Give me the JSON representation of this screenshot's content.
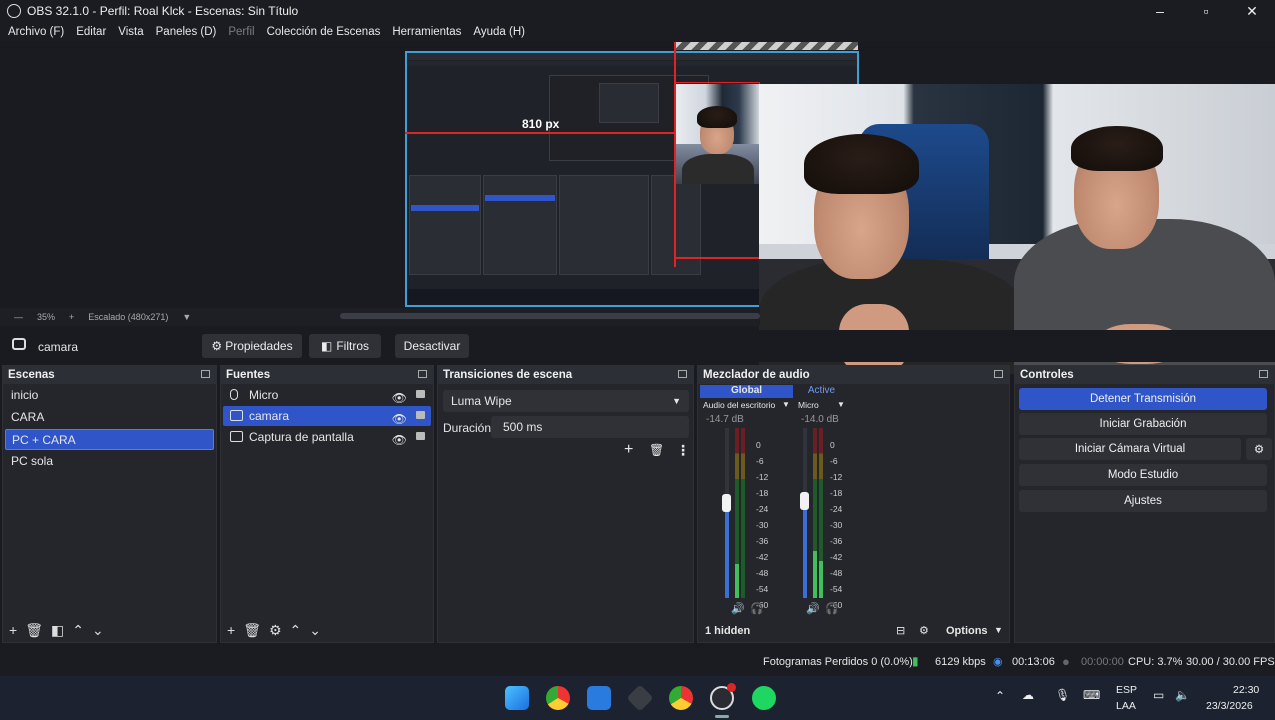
{
  "window": {
    "title": "OBS 32.1.0 - Perfil: Roal Klck - Escenas: Sin Título"
  },
  "menu": [
    "Archivo (F)",
    "Editar",
    "Vista",
    "Paneles (D)",
    "Perfil",
    "Colección de Escenas",
    "Herramientas",
    "Ayuda (H)"
  ],
  "preview": {
    "measure_label": "810 px"
  },
  "zoombar": {
    "zoom": "35%",
    "scaling": "Escalado (480x271)"
  },
  "source_toolbar": {
    "source_name": "camara",
    "properties": "Propiedades",
    "filters": "Filtros",
    "deactivate": "Desactivar"
  },
  "scenes": {
    "title": "Escenas",
    "items": [
      "inicio",
      "CARA",
      "PC + CARA",
      "PC sola"
    ],
    "selected": "PC + CARA"
  },
  "sources": {
    "title": "Fuentes",
    "items": [
      {
        "name": "Micro",
        "icon": "mic-icon"
      },
      {
        "name": "camara",
        "icon": "camera-icon"
      },
      {
        "name": "Captura de pantalla",
        "icon": "monitor-icon"
      }
    ],
    "selected": "camara"
  },
  "transitions": {
    "title": "Transiciones de escena",
    "transition": "Luma Wipe",
    "duration_label": "Duración",
    "duration_value": "500 ms"
  },
  "mixer": {
    "title": "Mezclador de audio",
    "tab_global": "Global",
    "tab_active": "Active",
    "channels": [
      {
        "name": "Audio del escritorio",
        "db": "-14.7 dB"
      },
      {
        "name": "Micro",
        "db": "-14.0 dB"
      }
    ],
    "scale": [
      "0",
      "-6",
      "-12",
      "-18",
      "-24",
      "-30",
      "-36",
      "-42",
      "-48",
      "-54",
      "-60"
    ],
    "hidden": "1 hidden",
    "options": "Options"
  },
  "controls": {
    "title": "Controles",
    "stop_stream": "Detener Transmisión",
    "start_recording": "Iniciar Grabación",
    "start_virtual_cam": "Iniciar Cámara Virtual",
    "studio_mode": "Modo Estudio",
    "settings": "Ajustes"
  },
  "status": {
    "dropped": "Fotogramas Perdidos 0 (0.0%)",
    "bitrate": "6129 kbps",
    "stream_time": "00:13:06",
    "rec_time": "00:00:00",
    "cpu": "CPU: 3.7%",
    "fps": "30.00 / 30.00 FPS"
  },
  "taskbar": {
    "lang_top": "ESP",
    "lang_bottom": "LAA",
    "time": "22:30",
    "date": "23/3/2026"
  },
  "colors": {
    "accent": "#2f55c8",
    "panel": "#24262c",
    "bg": "#1a1b20",
    "meter_green": "#3fc05a",
    "meter_red": "#c8323a"
  }
}
